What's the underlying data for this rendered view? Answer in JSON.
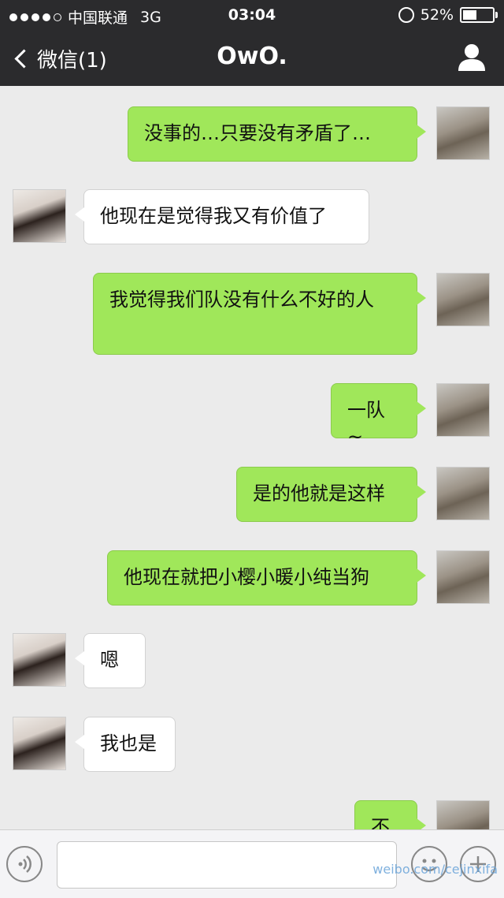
{
  "status_bar": {
    "carrier": "中国联通",
    "network": "3G",
    "time": "03:04",
    "battery": "52%",
    "battery_level": 0.52
  },
  "nav": {
    "back_label": "微信(1)",
    "title": "OwO."
  },
  "messages": [
    {
      "side": "me",
      "text": "没事的…只要没有矛盾了…"
    },
    {
      "side": "other",
      "text": "他现在是觉得我又有价值了"
    },
    {
      "side": "me",
      "text": "我觉得我们队没有什么不好的人"
    },
    {
      "side": "me",
      "text": "一队~"
    },
    {
      "side": "me",
      "text": "是的他就是这样"
    },
    {
      "side": "me",
      "text": "他现在就把小樱小暖小纯当狗"
    },
    {
      "side": "other",
      "text": "嗯"
    },
    {
      "side": "other",
      "text": "我也是"
    },
    {
      "side": "me",
      "text": "不"
    }
  ],
  "input_bar": {
    "watermark": "weibo.com/cejinxifa"
  },
  "colors": {
    "bar": "#2b2b2d",
    "my_bubble": "#a0e75a",
    "other_bubble": "#ffffff",
    "background": "#ebebeb"
  }
}
